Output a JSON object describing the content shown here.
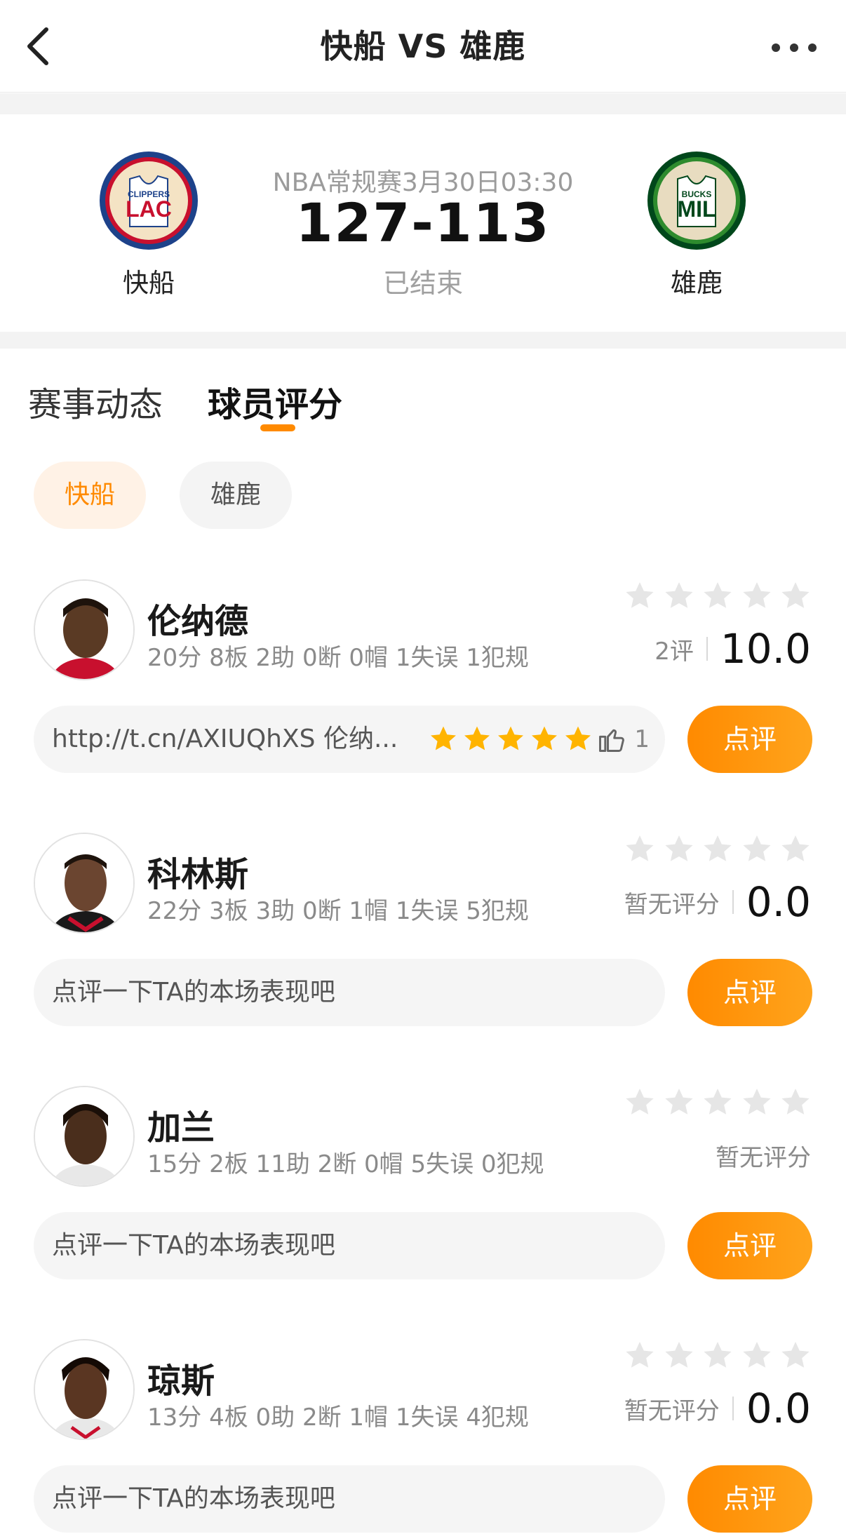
{
  "header": {
    "title": "快船 VS 雄鹿"
  },
  "match": {
    "home": {
      "name": "快船",
      "logo_text": "LAC",
      "logo_sub": "CLIPPERS",
      "color": "#c8102e"
    },
    "away": {
      "name": "雄鹿",
      "logo_text": "MIL",
      "logo_sub": "BUCKS",
      "color": "#00471b"
    },
    "meta": "NBA常规赛3月30日03:30",
    "score": "127-113",
    "status": "已结束"
  },
  "tabs": [
    {
      "label": "赛事动态",
      "active": false
    },
    {
      "label": "球员评分",
      "active": true
    }
  ],
  "team_filter": [
    {
      "label": "快船",
      "active": true
    },
    {
      "label": "雄鹿",
      "active": false
    }
  ],
  "players": [
    {
      "name": "伦纳德",
      "stats": "20分 8板 2助 0断 0帽 1失误 1犯规",
      "rating_count": "2评",
      "rating_score": "10.0",
      "comment": "http://t.cn/AXIUQhXS 伦纳...",
      "comment_stars": 5,
      "likes": "1",
      "button": "点评"
    },
    {
      "name": "科林斯",
      "stats": "22分 3板 3助 0断 1帽 1失误 5犯规",
      "rating_count": "暂无评分",
      "rating_score": "0.0",
      "comment": "点评一下TA的本场表现吧",
      "button": "点评"
    },
    {
      "name": "加兰",
      "stats": "15分 2板 11助 2断 0帽 5失误 0犯规",
      "rating_count": "暂无评分",
      "rating_score": "",
      "comment": "点评一下TA的本场表现吧",
      "button": "点评"
    },
    {
      "name": "琼斯",
      "stats": "13分 4板 0助 2断 1帽 1失误 4犯规",
      "rating_count": "暂无评分",
      "rating_score": "0.0",
      "comment": "点评一下TA的本场表现吧",
      "button": "点评"
    }
  ],
  "colors": {
    "accent": "#ff8a00",
    "pill_bg": "#fff2e6",
    "star_grey": "#e6e6e6",
    "star_gold": "#ffb400"
  }
}
